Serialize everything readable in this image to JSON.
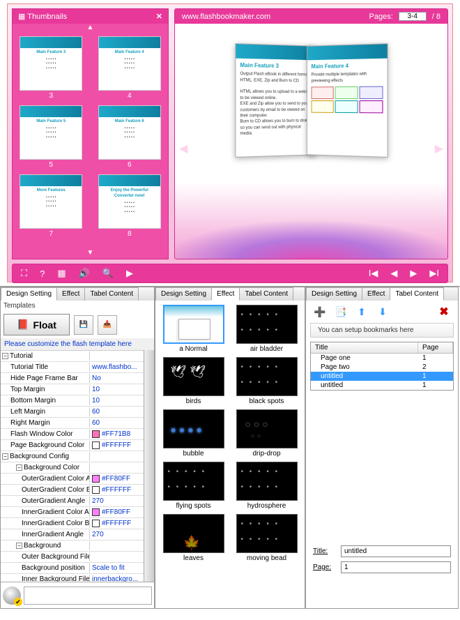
{
  "preview": {
    "thumbs_title": "Thumbnails",
    "thumbs": [
      {
        "num": "3",
        "title": "Main Feature 3"
      },
      {
        "num": "4",
        "title": "Main Feature 4"
      },
      {
        "num": "5",
        "title": "Main Feature 5"
      },
      {
        "num": "6",
        "title": "Main Feature 6"
      },
      {
        "num": "7",
        "title": "More Features"
      },
      {
        "num": "8",
        "title": "Enjoy the Powerful Converter now!"
      }
    ],
    "book_url": "www.flashbookmaker.com",
    "pages_label": "Pages:",
    "pages_value": "3-4",
    "pages_total": "/ 8",
    "page_left_title": "Main Feature 3",
    "page_left_text": "Output Flash eBook in different formats:\nHTML, EXE, Zip and Burn to CD\n\nHTML allows you to upload to a website to be viewed online.\nEXE and Zip allow you to send to your customers by email to be viewed on their computer.\nBurn to CD allows you to burn to disk so you can send out with physical media.",
    "page_right_title": "Main Feature 4",
    "page_right_text": "Provide multiple templates with previewing effects"
  },
  "col1": {
    "tabs": [
      "Design Setting",
      "Effect",
      "Tabel Content"
    ],
    "templates_label": "Templates",
    "float_btn": "Float",
    "customize_text": "Please customize the flash template here",
    "props": {
      "tutorial": "Tutorial",
      "tutorial_title_label": "Tutorial Title",
      "tutorial_title_value": "www.flashbo...",
      "hide_frame_label": "Hide Page Frame Bar",
      "hide_frame_value": "No",
      "top_margin_label": "Top Margin",
      "top_margin_value": "10",
      "bottom_margin_label": "Bottom Margin",
      "bottom_margin_value": "10",
      "left_margin_label": "Left Margin",
      "left_margin_value": "60",
      "right_margin_label": "Right Margin",
      "right_margin_value": "60",
      "flash_window_color_label": "Flash Window Color",
      "flash_window_color_value": "#FF71B8",
      "page_bg_color_label": "Page Background Color",
      "page_bg_color_value": "#FFFFFF",
      "bg_config": "Background Config",
      "bg_color": "Background Color",
      "outer_a_label": "OuterGradient Color A",
      "outer_a_value": "#FF80FF",
      "outer_b_label": "OuterGradient Color B",
      "outer_b_value": "#FFFFFF",
      "outer_angle_label": "OuterGradient Angle",
      "outer_angle_value": "270",
      "inner_a_label": "InnerGradient Color A",
      "inner_a_value": "#FF80FF",
      "inner_b_label": "InnerGradient Color B",
      "inner_b_value": "#FFFFFF",
      "inner_angle_label": "InnerGradient Angle",
      "inner_angle_value": "270",
      "background": "Background",
      "outer_bg_file_label": "Outer Background File",
      "outer_bg_file_value": "",
      "bg_position_label": "Background position",
      "bg_position_value": "Scale to fit",
      "inner_bg_file_label": "Inner Background File",
      "inner_bg_file_value": "innerbackgro..."
    }
  },
  "col2": {
    "tabs": [
      "Design Setting",
      "Effect",
      "Tabel Content"
    ],
    "effects": [
      {
        "label": "a Normal",
        "fx": "normal",
        "selected": true
      },
      {
        "label": "air bladder",
        "fx": "dots"
      },
      {
        "label": "birds",
        "fx": "birds"
      },
      {
        "label": "black spots",
        "fx": "dots"
      },
      {
        "label": "bubble",
        "fx": "bubbles"
      },
      {
        "label": "drip-drop",
        "fx": "rings"
      },
      {
        "label": "flying spots",
        "fx": "dots"
      },
      {
        "label": "hydrosphere",
        "fx": "dots"
      },
      {
        "label": "leaves",
        "fx": "leaves"
      },
      {
        "label": "moving bead",
        "fx": "dots"
      }
    ]
  },
  "col3": {
    "tabs": [
      "Design Setting",
      "Effect",
      "Tabel Content"
    ],
    "hint": "You can setup bookmarks here",
    "head_title": "Title",
    "head_page": "Page",
    "rows": [
      {
        "title": "Page one",
        "page": "1",
        "selected": false
      },
      {
        "title": "Page two",
        "page": "2",
        "selected": false
      },
      {
        "title": "untitled",
        "page": "1",
        "selected": true
      },
      {
        "title": "untitled",
        "page": "1",
        "selected": false
      }
    ],
    "form_title_label": "Title:",
    "form_title_value": "untitled",
    "form_page_label": "Page:",
    "form_page_value": "1"
  },
  "colors": {
    "ff71b8": "#FF71B8",
    "ffffff": "#FFFFFF",
    "ff80ff": "#FF80FF"
  }
}
